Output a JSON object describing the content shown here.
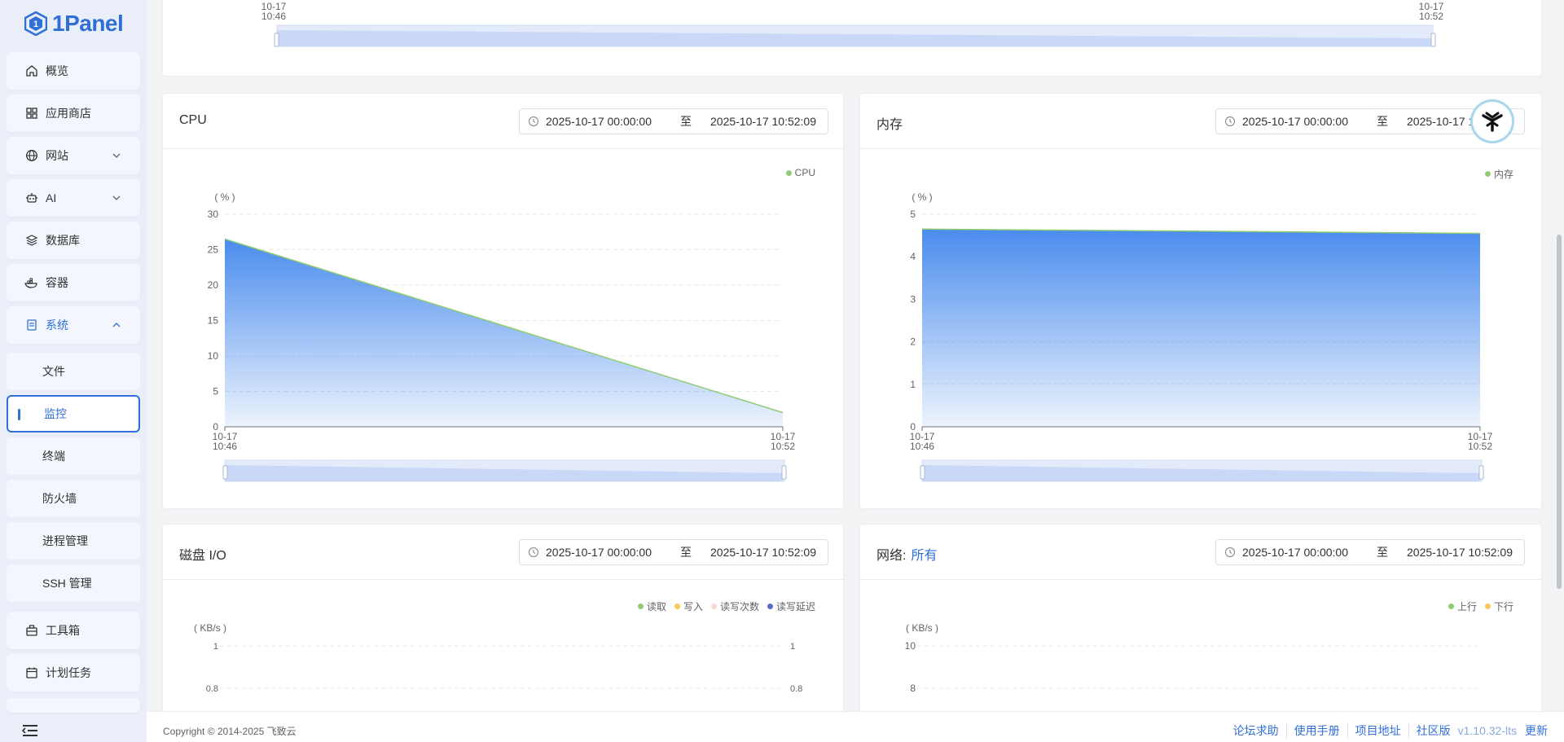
{
  "app": {
    "logo_text": "1Panel"
  },
  "sidebar": {
    "items": [
      {
        "label": "概览",
        "icon": "home-icon"
      },
      {
        "label": "应用商店",
        "icon": "grid-icon"
      },
      {
        "label": "网站",
        "icon": "globe-icon",
        "expandable": true
      },
      {
        "label": "AI",
        "icon": "robot-icon",
        "expandable": true
      },
      {
        "label": "数据库",
        "icon": "layers-icon"
      },
      {
        "label": "容器",
        "icon": "docker-icon"
      },
      {
        "label": "系统",
        "icon": "server-icon",
        "expanded": true
      },
      {
        "label": "工具箱",
        "icon": "toolbox-icon"
      },
      {
        "label": "计划任务",
        "icon": "calendar-icon"
      }
    ],
    "sub_items": [
      {
        "label": "文件"
      },
      {
        "label": "监控",
        "current": true
      },
      {
        "label": "终端"
      },
      {
        "label": "防火墙"
      },
      {
        "label": "进程管理"
      },
      {
        "label": "SSH 管理"
      }
    ]
  },
  "top_chart": {
    "x_start": [
      "10-17",
      "10:46"
    ],
    "x_end": [
      "10-17",
      "10:52"
    ]
  },
  "cpu": {
    "title": "CPU",
    "range_start": "2025-10-17 00:00:00",
    "range_sep": "至",
    "range_end": "2025-10-17 10:52:09"
  },
  "memory": {
    "title": "内存",
    "range_start": "2025-10-17 00:00:00",
    "range_sep": "至",
    "range_end": "2025-10-17 10:52:09"
  },
  "disk": {
    "title": "磁盘 I/O",
    "range_start": "2025-10-17 00:00:00",
    "range_sep": "至",
    "range_end": "2025-10-17 10:52:09"
  },
  "network": {
    "title": "网络:",
    "link": "所有",
    "range_start": "2025-10-17 00:00:00",
    "range_sep": "至",
    "range_end": "2025-10-17 10:52:09"
  },
  "chart_data": [
    {
      "type": "area",
      "title": "",
      "legend": [
        "CPU"
      ],
      "ylabel": "( % )",
      "ylim": [
        0,
        30
      ],
      "yticks": [
        0,
        5,
        10,
        15,
        20,
        25,
        30
      ],
      "x": [
        "10-17 10:46",
        "10-17 10:52"
      ],
      "series": [
        {
          "name": "CPU",
          "values": [
            26.5,
            2
          ]
        }
      ],
      "colors": {
        "line": "#91cc75",
        "fill": "#4a8ced"
      },
      "legend_position": "top-right"
    },
    {
      "type": "area",
      "title": "",
      "legend": [
        "内存"
      ],
      "ylabel": "( % )",
      "ylim": [
        0,
        5
      ],
      "yticks": [
        0,
        1,
        2,
        3,
        4,
        5
      ],
      "x": [
        "10-17 10:46",
        "10-17 10:52"
      ],
      "series": [
        {
          "name": "内存",
          "values": [
            4.65,
            4.55
          ]
        }
      ],
      "colors": {
        "line": "#91cc75",
        "fill": "#4a8ced"
      },
      "legend_position": "top-right"
    },
    {
      "type": "line",
      "legend": [
        "读取",
        "写入",
        "读写次数",
        "读写延迟"
      ],
      "legend_colors": [
        "#91cc75",
        "#fac858",
        "#fcd5d5",
        "#5470c6"
      ],
      "ylabel": "( KB/s )",
      "yticks_visible": [
        1,
        0.8
      ],
      "yticks_right_visible": [
        1,
        0.8
      ],
      "legend_position": "top-right"
    },
    {
      "type": "line",
      "legend": [
        "上行",
        "下行"
      ],
      "legend_colors": [
        "#91cc75",
        "#fac858"
      ],
      "ylabel": "( KB/s )",
      "yticks_visible": [
        10,
        8
      ],
      "legend_position": "top-right"
    }
  ],
  "footer": {
    "copyright": "Copyright © 2014-2025 飞致云",
    "links": [
      "论坛求助",
      "使用手册",
      "项目地址",
      "社区版"
    ],
    "version": "v1.10.32-lts",
    "update": "更新"
  }
}
